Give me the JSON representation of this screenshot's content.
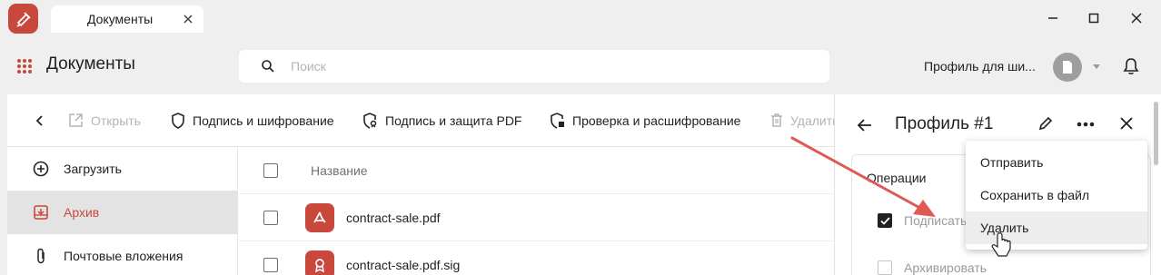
{
  "window": {
    "tab_title": "Документы",
    "controls": [
      "minimize-icon",
      "maximize-icon",
      "close-icon"
    ]
  },
  "header": {
    "app_title": "Документы",
    "search_placeholder": "Поиск",
    "search_value": "",
    "profile_name": "Профиль для ши..."
  },
  "toolbar": {
    "back_icon": "chevron-left-icon",
    "items": [
      {
        "label": "Открыть",
        "icon": "open-external-icon",
        "disabled": true
      },
      {
        "label": "Подпись и шифрование",
        "icon": "shield-icon",
        "disabled": false
      },
      {
        "label": "Подпись и защита PDF",
        "icon": "pdf-sign-icon",
        "disabled": false
      },
      {
        "label": "Проверка и расшифрование",
        "icon": "shield-check-icon",
        "disabled": false
      },
      {
        "label": "Удалить",
        "icon": "trash-icon",
        "disabled": true
      }
    ]
  },
  "sidebar": {
    "items": [
      {
        "label": "Загрузить",
        "icon": "plus-circle-icon",
        "active": false
      },
      {
        "label": "Архив",
        "icon": "archive-icon",
        "active": true
      },
      {
        "label": "Почтовые вложения",
        "icon": "paperclip-icon",
        "active": false
      }
    ]
  },
  "files": {
    "column_name": "Название",
    "rows": [
      {
        "name": "contract-sale.pdf",
        "icon": "pdf-icon",
        "checked": false
      },
      {
        "name": "contract-sale.pdf.sig",
        "icon": "signature-icon",
        "checked": false
      }
    ]
  },
  "panel": {
    "title": "Профиль #1",
    "operations_title": "Операции",
    "operations": [
      {
        "label": "Подписать",
        "checked": true
      },
      {
        "label": "Архивировать",
        "checked": false
      }
    ]
  },
  "menu": {
    "items": [
      "Отправить",
      "Сохранить в файл",
      "Удалить"
    ],
    "hovered_index": 2
  },
  "colors": {
    "accent": "#c8493c",
    "background": "#efefef",
    "surface": "#ffffff",
    "annotation_arrow": "#e05a55"
  }
}
